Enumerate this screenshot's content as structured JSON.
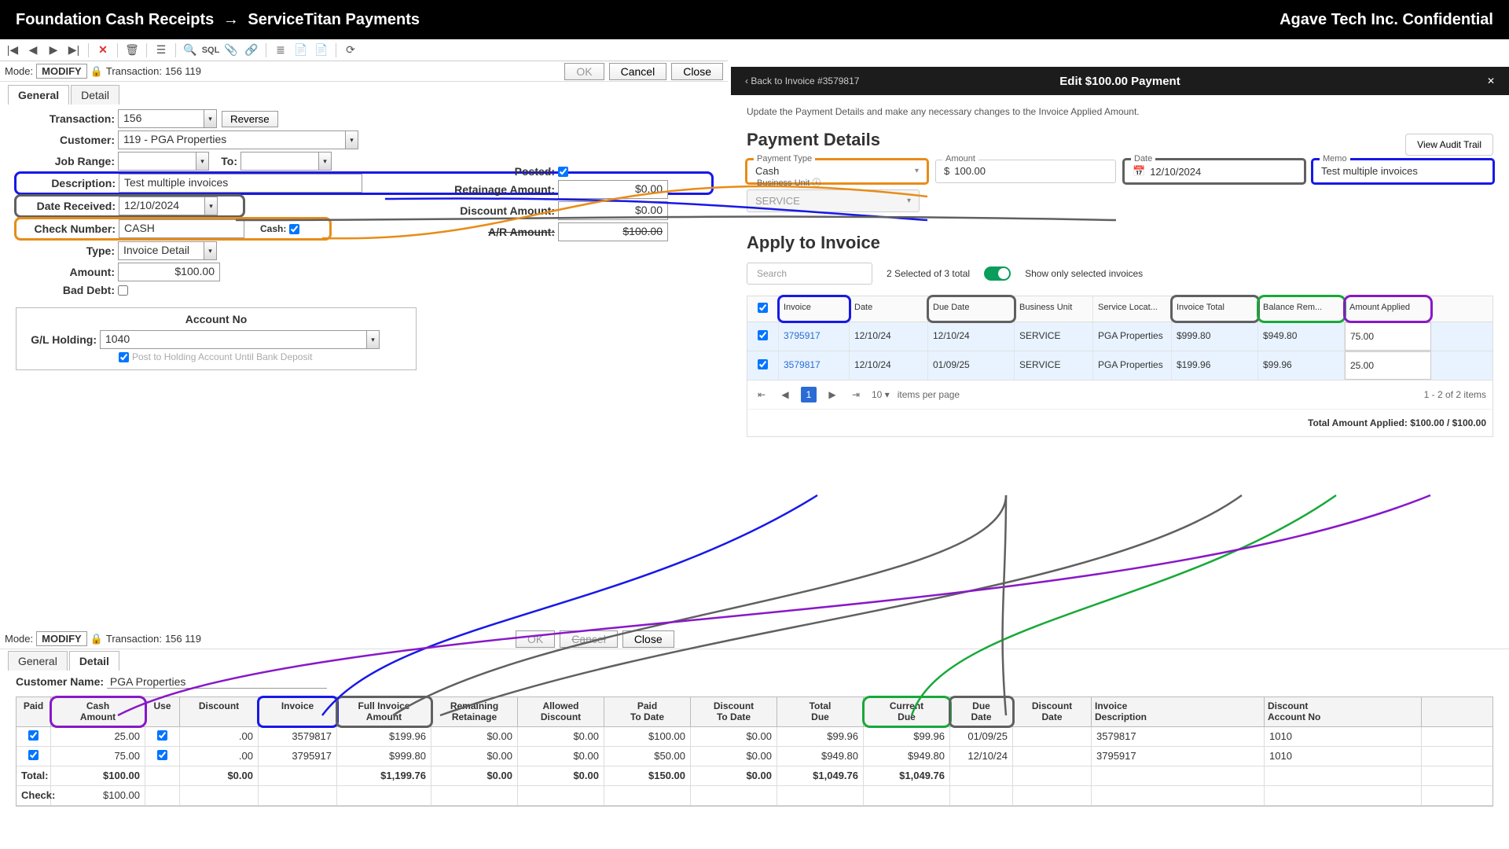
{
  "top": {
    "left": "Foundation Cash Receipts",
    "arrow": "→",
    "right": "ServiceTitan Payments",
    "confidential": "Agave Tech Inc. Confidential"
  },
  "foundation": {
    "mode_lbl": "Mode:",
    "mode": "MODIFY",
    "trans_lbl": "Transaction:",
    "trans": "156  119",
    "buttons": {
      "ok": "OK",
      "cancel": "Cancel",
      "close": "Close"
    },
    "tabs": {
      "general": "General",
      "detail": "Detail"
    },
    "fields": {
      "transaction_lbl": "Transaction:",
      "transaction": "156",
      "reverse": "Reverse",
      "customer_lbl": "Customer:",
      "customer": "119  - PGA Properties",
      "jobrange_lbl": "Job Range:",
      "jobrange_from": "",
      "to_lbl": "To:",
      "jobrange_to": "",
      "description_lbl": "Description:",
      "description": "Test multiple invoices",
      "date_received_lbl": "Date Received:",
      "date_received": "12/10/2024",
      "check_number_lbl": "Check Number:",
      "check_number": "CASH",
      "cash_lbl": "Cash:",
      "type_lbl": "Type:",
      "type": "Invoice Detail",
      "amount_lbl": "Amount:",
      "amount": "$100.00",
      "bad_debt_lbl": "Bad Debt:"
    },
    "right_fields": {
      "posted_lbl": "Posted:",
      "retainage_lbl": "Retainage Amount:",
      "retainage": "$0.00",
      "discount_lbl": "Discount Amount:",
      "discount": "$0.00",
      "ar_lbl": "A/R Amount:",
      "ar": "$100.00"
    },
    "account": {
      "title": "Account No",
      "gl_lbl": "G/L Holding:",
      "gl": "1040",
      "post_lbl": "Post to Holding Account Until Bank Deposit"
    }
  },
  "st": {
    "back": "Back to Invoice #3579817",
    "title": "Edit $100.00 Payment",
    "subtitle": "Update the Payment Details and make any necessary changes to the Invoice Applied Amount.",
    "details_title": "Payment Details",
    "audit": "View Audit Trail",
    "fields": {
      "ptype_lbl": "Payment Type",
      "ptype": "Cash",
      "amount_lbl": "Amount",
      "amount": "100.00",
      "date_lbl": "Date",
      "date": "12/10/2024",
      "memo_lbl": "Memo",
      "memo": "Test multiple invoices",
      "bu_lbl": "Business Unit",
      "bu": "SERVICE"
    },
    "apply_title": "Apply to Invoice",
    "search_placeholder": "Search",
    "selected": "2 Selected of 3 total",
    "show_only": "Show only selected invoices",
    "cols": {
      "invoice": "Invoice",
      "date": "Date",
      "due": "Due Date",
      "bu": "Business Unit",
      "sl": "Service Locat...",
      "total": "Invoice Total",
      "bal": "Balance Rem...",
      "amt": "Amount Applied"
    },
    "rows": [
      {
        "inv": "3795917",
        "date": "12/10/24",
        "due": "12/10/24",
        "bu": "SERVICE",
        "sl": "PGA Properties",
        "tot": "$999.80",
        "bal": "$949.80",
        "amt": "75.00"
      },
      {
        "inv": "3579817",
        "date": "12/10/24",
        "due": "01/09/25",
        "bu": "SERVICE",
        "sl": "PGA Properties",
        "tot": "$199.96",
        "bal": "$99.96",
        "amt": "25.00"
      }
    ],
    "pager": {
      "ipp": "10",
      "ipp_lbl": "items per page",
      "range": "1 - 2 of 2 items"
    },
    "total_lbl": "Total Amount Applied:",
    "total_val": "$100.00 / $100.00"
  },
  "detail": {
    "customer_lbl": "Customer Name:",
    "customer": "PGA Properties",
    "cols": {
      "paid": "Paid",
      "cash": "Cash\nAmount",
      "use": "Use",
      "disc": "Discount",
      "inv": "Invoice",
      "full": "Full Invoice\nAmount",
      "ret": "Remaining\nRetainage",
      "allow": "Allowed\nDiscount",
      "ptd": "Paid\nTo Date",
      "dtd": "Discount\nTo Date",
      "tdue": "Total\nDue",
      "cdue": "Current\nDue",
      "ddate": "Due\nDate",
      "discdate": "Discount\nDate",
      "idesc": "Invoice\nDescription",
      "dacct": "Discount\nAccount No"
    },
    "rows": [
      {
        "cash": "25.00",
        "disc": ".00",
        "inv": "3579817",
        "full": "$199.96",
        "ret": "$0.00",
        "allow": "$0.00",
        "ptd": "$100.00",
        "dtd": "$0.00",
        "tdue": "$99.96",
        "cdue": "$99.96",
        "ddate": "01/09/25",
        "discdate": "",
        "idesc": "3579817",
        "dacct": "1010"
      },
      {
        "cash": "75.00",
        "disc": ".00",
        "inv": "3795917",
        "full": "$999.80",
        "ret": "$0.00",
        "allow": "$0.00",
        "ptd": "$50.00",
        "dtd": "$0.00",
        "tdue": "$949.80",
        "cdue": "$949.80",
        "ddate": "12/10/24",
        "discdate": "",
        "idesc": "3795917",
        "dacct": "1010"
      }
    ],
    "total_lbl": "Total:",
    "check_lbl": "Check:",
    "totals": {
      "cash": "$100.00",
      "disc": "$0.00",
      "full": "$1,199.76",
      "ret": "$0.00",
      "allow": "$0.00",
      "ptd": "$150.00",
      "dtd": "$0.00",
      "tdue": "$1,049.76",
      "cdue": "$1,049.76",
      "check": "$100.00"
    }
  }
}
